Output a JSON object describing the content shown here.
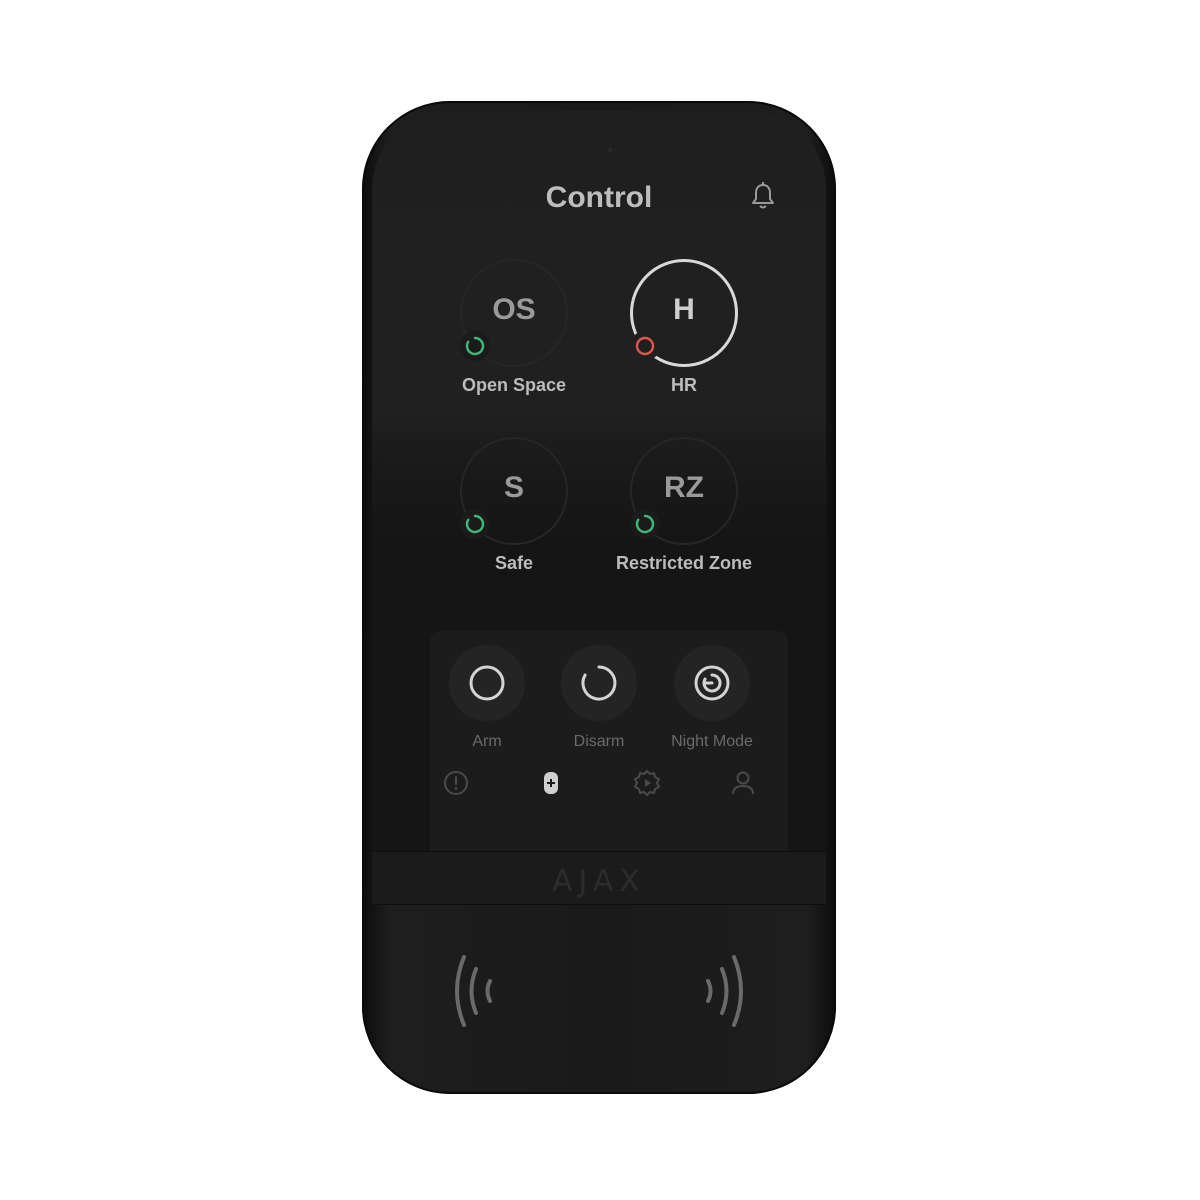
{
  "header": {
    "title": "Control"
  },
  "groups": [
    {
      "initials": "OS",
      "label": "Open Space",
      "status_color": "#3fb87a",
      "active": false
    },
    {
      "initials": "H",
      "label": "HR",
      "status_color": "#e0564c",
      "active": true
    },
    {
      "initials": "S",
      "label": "Safe",
      "status_color": "#3fb87a",
      "active": false
    },
    {
      "initials": "RZ",
      "label": "Restricted Zone",
      "status_color": "#3fb87a",
      "active": false
    }
  ],
  "modes": [
    {
      "label": "Arm",
      "icon": "arm-icon"
    },
    {
      "label": "Disarm",
      "icon": "disarm-icon"
    },
    {
      "label": "Night Mode",
      "icon": "night-mode-icon"
    }
  ],
  "nav": [
    {
      "icon": "alert-icon"
    },
    {
      "icon": "device-icon"
    },
    {
      "icon": "scenario-gear-icon"
    },
    {
      "icon": "user-icon"
    }
  ],
  "brand": {
    "logo_text": "AJAX"
  }
}
